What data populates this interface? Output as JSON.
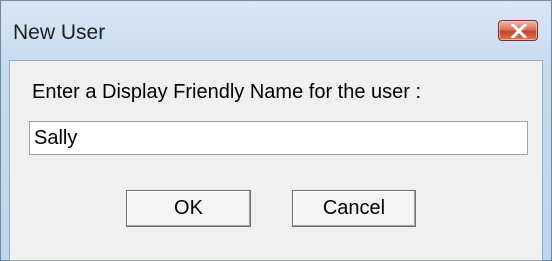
{
  "window": {
    "title": "New User",
    "close_icon": "close-icon"
  },
  "dialog": {
    "prompt": "Enter a Display Friendly Name for the user :",
    "name_value": "Sally",
    "ok_label": "OK",
    "cancel_label": "Cancel"
  },
  "colors": {
    "close_button": "#c8452a",
    "title_bar": "#c8dbf0",
    "client_bg": "#f0f0f0"
  }
}
